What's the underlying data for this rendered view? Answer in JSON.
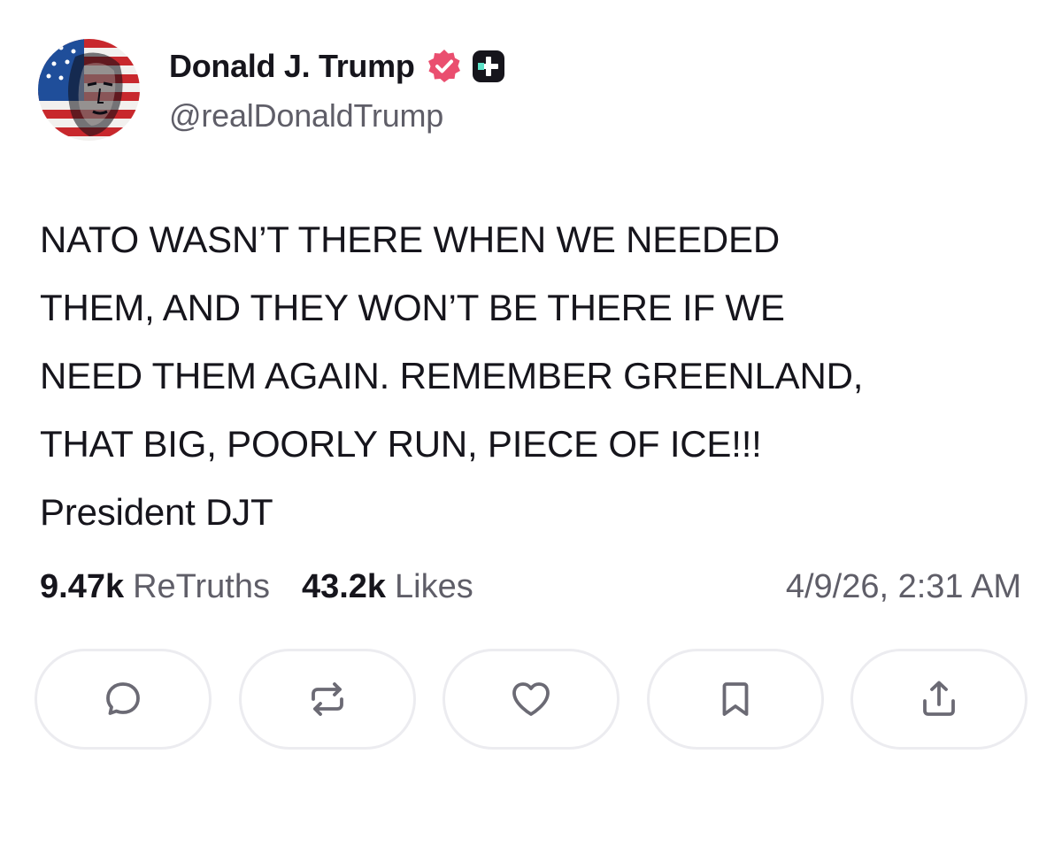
{
  "author": {
    "name": "Donald J. Trump",
    "handle": "@realDonaldTrump",
    "verified_color": "#ea4e6f",
    "avatar_icon": "flag-portrait-avatar"
  },
  "post": {
    "text": "NATO WASN’T THERE WHEN WE NEEDED\nTHEM, AND THEY WON’T BE THERE IF WE\nNEED THEM AGAIN. REMEMBER GREENLAND,\nTHAT BIG, POORLY RUN, PIECE OF ICE!!!\nPresident DJT"
  },
  "stats": {
    "retruths_count": "9.47k",
    "retruths_label": "ReTruths",
    "likes_count": "43.2k",
    "likes_label": "Likes",
    "timestamp": "4/9/26, 2:31 AM"
  },
  "actions": [
    {
      "icon": "reply-icon"
    },
    {
      "icon": "retruth-icon"
    },
    {
      "icon": "heart-icon"
    },
    {
      "icon": "bookmark-icon"
    },
    {
      "icon": "share-icon"
    }
  ],
  "colors": {
    "text": "#16151c",
    "muted": "#5f5e68",
    "border": "#ececf0",
    "icon": "#6b6a74"
  }
}
